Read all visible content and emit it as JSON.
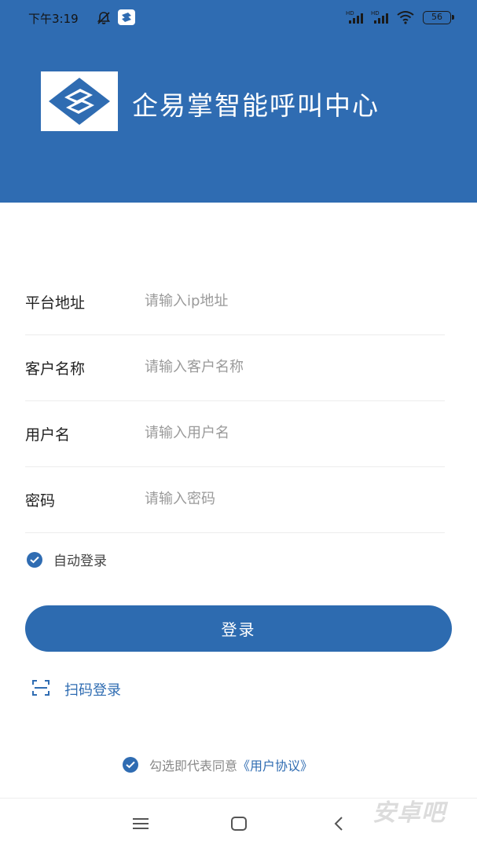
{
  "status_bar": {
    "time": "下午3:19",
    "battery": "56"
  },
  "header": {
    "title": "企易掌智能呼叫中心",
    "color": "#2f6cb2"
  },
  "form": {
    "fields": [
      {
        "label": "平台地址",
        "placeholder": "请输入ip地址"
      },
      {
        "label": "客户名称",
        "placeholder": "请输入客户名称"
      },
      {
        "label": "用户名",
        "placeholder": "请输入用户名"
      },
      {
        "label": "密码",
        "placeholder": "请输入密码"
      }
    ],
    "auto_login": {
      "label": "自动登录",
      "checked": true
    }
  },
  "login_button": {
    "label": "登录"
  },
  "scan_login": {
    "label": "扫码登录"
  },
  "agreement": {
    "prefix": "勾选即代表同意",
    "link": "《用户协议》",
    "checked": true
  },
  "watermark": "安卓吧",
  "icons": {
    "status": [
      "mute-bell-icon",
      "app-notification-icon",
      "signal-icon",
      "signal-icon",
      "wifi-icon",
      "battery-icon"
    ],
    "nav": [
      "menu-icon",
      "home-square-icon",
      "back-chevron-icon"
    ]
  }
}
